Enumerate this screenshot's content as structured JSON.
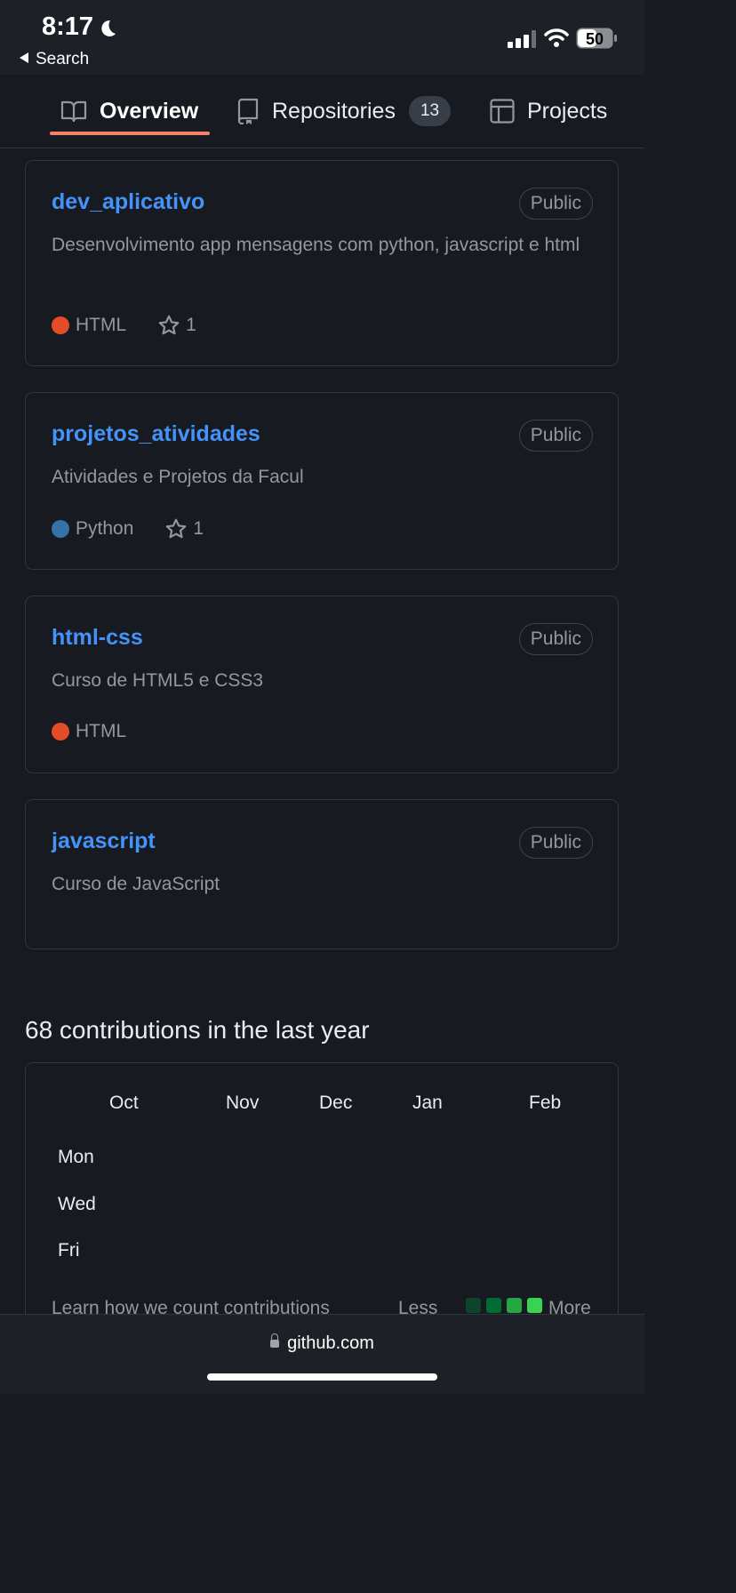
{
  "status_bar": {
    "time": "8:17",
    "back_label": "Search",
    "battery": "50"
  },
  "tabs": [
    {
      "label": "Overview",
      "icon": "book-icon",
      "active": true
    },
    {
      "label": "Repositories",
      "icon": "repo-icon",
      "count": "13"
    },
    {
      "label": "Projects",
      "icon": "table-icon"
    }
  ],
  "repos": [
    {
      "name": "dev_aplicativo",
      "visibility": "Public",
      "description": "Desenvolvimento app mensagens com python, javascript e html",
      "language": "HTML",
      "language_color": "#e34c26",
      "stars": "1"
    },
    {
      "name": "projetos_atividades",
      "visibility": "Public",
      "description": "Atividades e Projetos da Facul",
      "language": "Python",
      "language_color": "#3572A5",
      "stars": "1"
    },
    {
      "name": "html-css",
      "visibility": "Public",
      "description": "Curso de HTML5 e CSS3",
      "language": "HTML",
      "language_color": "#e34c26"
    },
    {
      "name": "javascript",
      "visibility": "Public",
      "description": "Curso de JavaScript"
    }
  ],
  "contributions": {
    "title": "68 contributions in the last year",
    "months": [
      "Oct",
      "Nov",
      "Dec",
      "Jan",
      "Feb"
    ],
    "days": [
      "Mon",
      "Wed",
      "Fri"
    ],
    "learn_link": "Learn how we count contributions",
    "legend_less": "Less",
    "legend_more": "More",
    "legend_colors": [
      "#0e4429",
      "#006d32",
      "#26a641",
      "#39d353"
    ]
  },
  "browser": {
    "url": "github.com"
  }
}
